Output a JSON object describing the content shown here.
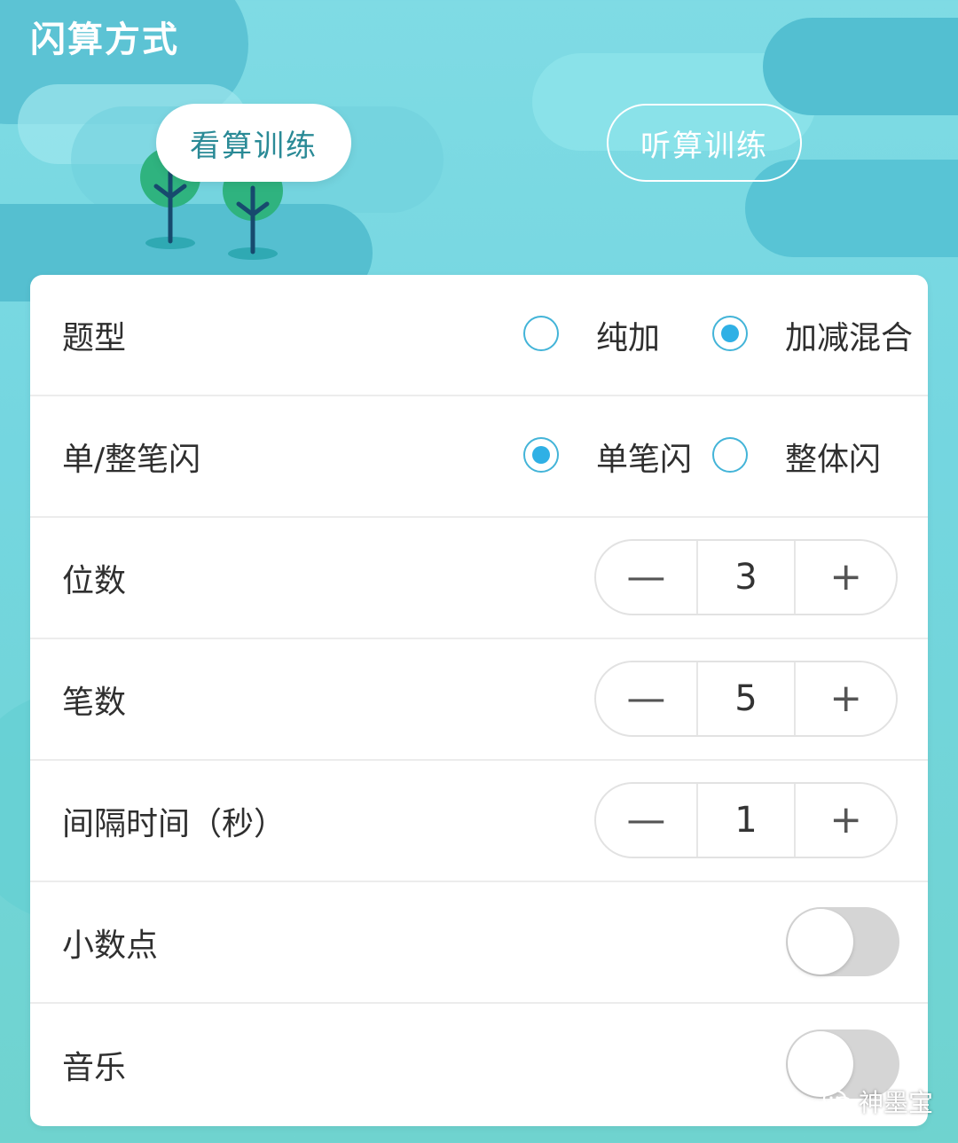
{
  "header": {
    "title": "闪算方式"
  },
  "mode_tabs": [
    {
      "label": "看算训练",
      "active": true
    },
    {
      "label": "听算训练",
      "active": false
    }
  ],
  "settings": {
    "question_type": {
      "label": "题型",
      "options": [
        {
          "label": "纯加",
          "checked": false
        },
        {
          "label": "加减混合",
          "checked": true
        }
      ]
    },
    "flash_mode": {
      "label": "单/整笔闪",
      "options": [
        {
          "label": "单笔闪",
          "checked": true
        },
        {
          "label": "整体闪",
          "checked": false
        }
      ]
    },
    "digits": {
      "label": "位数",
      "value": "3",
      "minus": "—",
      "plus": "+"
    },
    "terms": {
      "label": "笔数",
      "value": "5",
      "minus": "—",
      "plus": "+"
    },
    "interval": {
      "label": "间隔时间（秒）",
      "value": "1",
      "minus": "—",
      "plus": "+"
    },
    "decimal_point": {
      "label": "小数点",
      "on": false
    },
    "music": {
      "label": "音乐",
      "on": false
    }
  },
  "watermark": {
    "text": "神墨宝"
  },
  "colors": {
    "accent": "#2fb0e5",
    "tab_text": "#2a8a96",
    "toggle_off": "#d5d5d5"
  }
}
